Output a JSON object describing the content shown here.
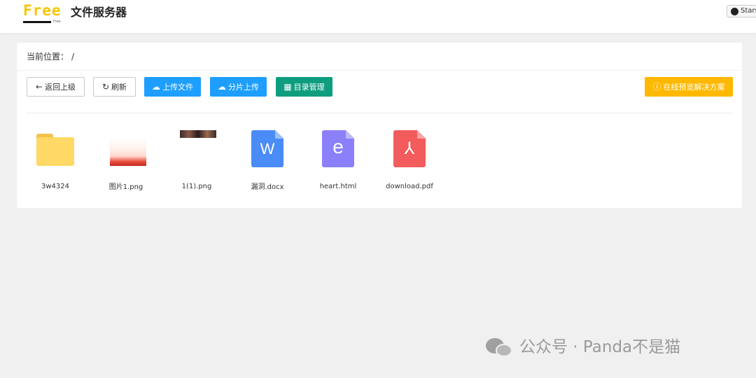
{
  "header": {
    "logo_text": "Free",
    "logo_small": "Free",
    "app_title": "文件服务器",
    "stars_label": "Stars"
  },
  "breadcrumb": {
    "label": "当前位置：",
    "path": "/"
  },
  "toolbar": {
    "back_label": "返回上级",
    "refresh_label": "刷新",
    "upload_label": "上传文件",
    "chunk_upload_label": "分片上传",
    "dir_manage_label": "目录管理",
    "preview_solution_label": "在线预览解决方案"
  },
  "files": [
    {
      "name": "3w4324",
      "type": "folder"
    },
    {
      "name": "图片1.png",
      "type": "image"
    },
    {
      "name": "1(1).png",
      "type": "image"
    },
    {
      "name": "漏洞.docx",
      "type": "docx",
      "glyph": "W"
    },
    {
      "name": "heart.html",
      "type": "html",
      "glyph": "e"
    },
    {
      "name": "download.pdf",
      "type": "pdf",
      "glyph": "⅄"
    }
  ],
  "colors": {
    "primary_blue": "#1e9fff",
    "green": "#0f9d7f",
    "orange": "#ffb800",
    "logo_yellow": "#f7c600",
    "word_blue": "#4a8cf7",
    "html_purple": "#8b80f9",
    "pdf_red": "#f25c5c"
  },
  "watermark": {
    "text": "公众号 · Panda不是猫"
  }
}
